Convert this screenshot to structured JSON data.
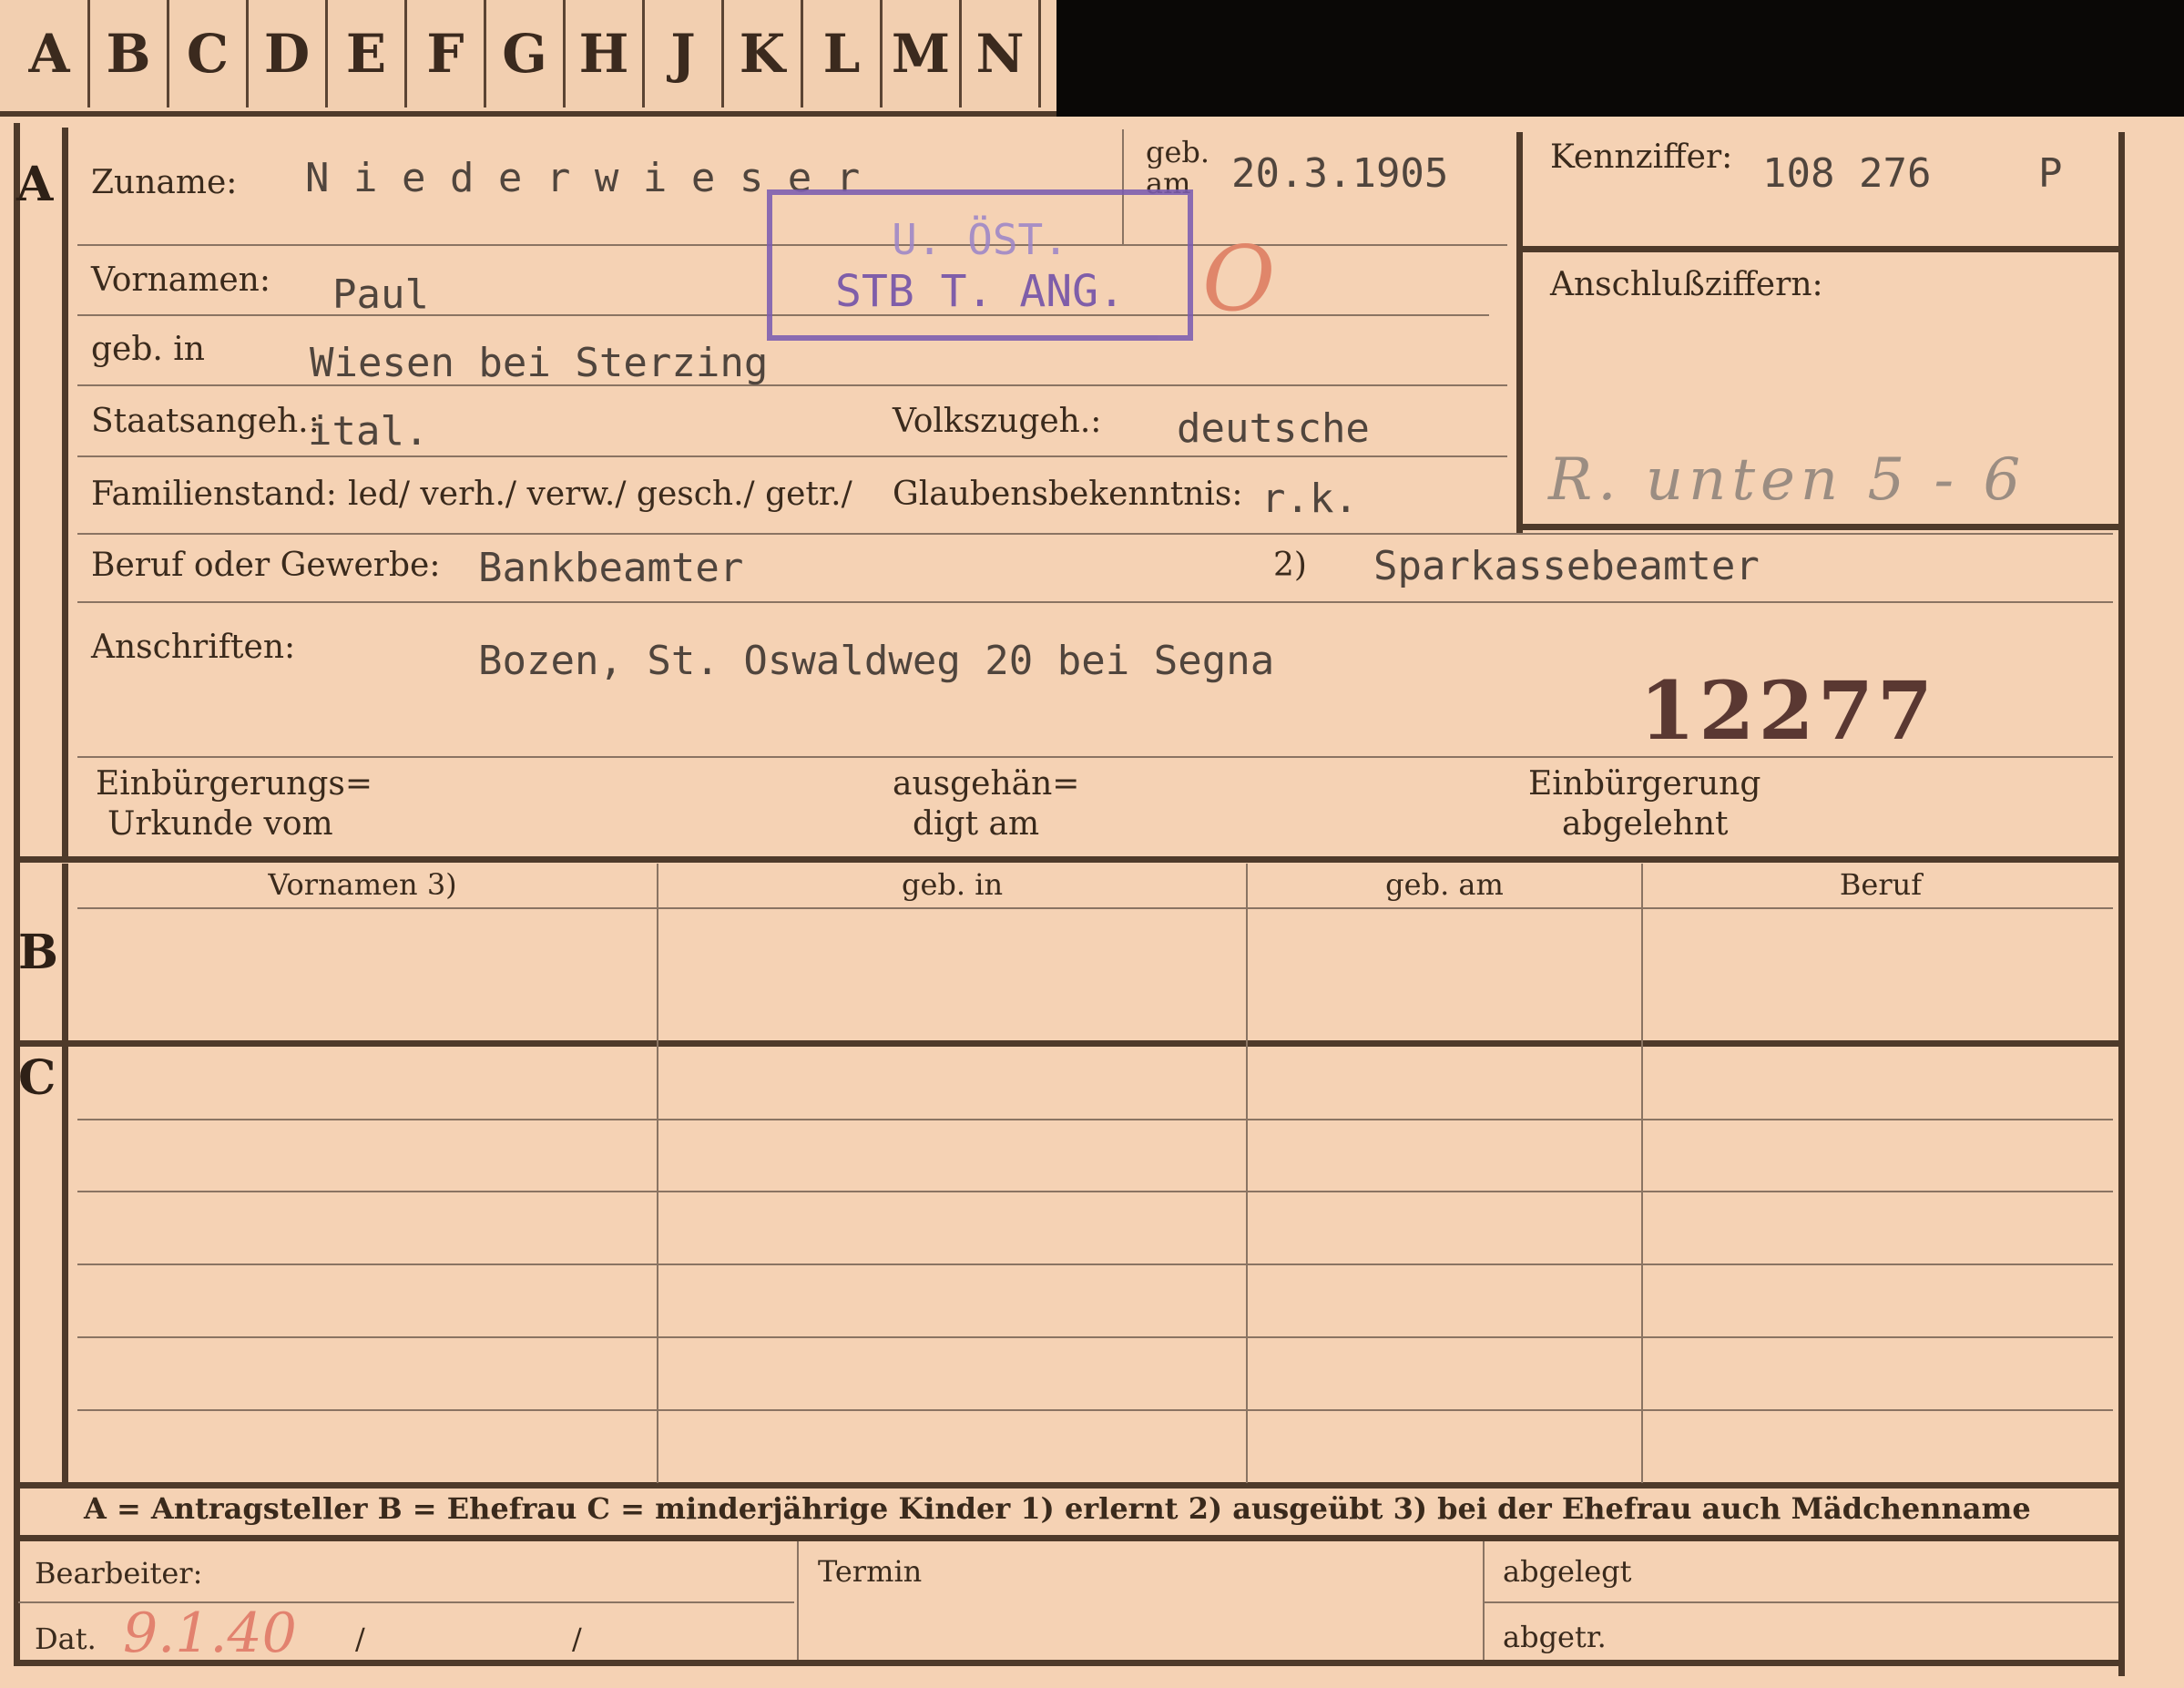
{
  "tabs": [
    "A",
    "B",
    "C",
    "D",
    "E",
    "F",
    "G",
    "H",
    "J",
    "K",
    "L",
    "M",
    "N"
  ],
  "sections": {
    "a": "A",
    "b": "B",
    "c": "C"
  },
  "labels": {
    "zuname": "Zuname:",
    "geb_am": "geb.\nam",
    "kennziffer": "Kennziffer:",
    "vornamen": "Vornamen:",
    "anschluss": "Anschlußziffern:",
    "geb_in": "geb. in",
    "staatsangeh": "Staatsangeh.:",
    "volkszugeh": "Volkszugeh.:",
    "familienstand": "Familienstand:",
    "familienstand_options": "led/ verh./ verw./ gesch./ getr./",
    "glaubens": "Glaubensbekenntnis:",
    "beruf": "Beruf oder Gewerbe:",
    "beruf_note": "2)",
    "anschriften": "Anschriften:",
    "einb_urkunde_1": "Einbürgerungs=",
    "einb_urkunde_2": "Urkunde vom",
    "ausgehaend_1": "ausgehän=",
    "ausgehaend_2": "digt am",
    "einb_abgelehnt_1": "Einbürgerung",
    "einb_abgelehnt_2": "abgelehnt"
  },
  "values": {
    "zuname": "N i e d e r w i e s e r",
    "geb_am": "20.3.1905",
    "kennziffer": "108 276",
    "kennziffer_suffix": "P",
    "vornamen": "Paul",
    "geb_in": "Wiesen bei Sterzing",
    "staatsangeh": "ital.",
    "volkszugeh": "deutsche",
    "glaubens": "r.k.",
    "beruf": "Bankbeamter",
    "beruf_ausgeuebt": "Sparkassebeamter",
    "anschrift": "Bozen, St. Oswaldweg 20 bei Segna",
    "number": "12277"
  },
  "stamp": {
    "line1": "U.  ÖST.",
    "line2": "STB  T. ANG."
  },
  "handwriting": {
    "anschluss": "R. unten  5 - 6",
    "mark": "O",
    "datum": "9.1.40"
  },
  "table_headers": [
    "Vornamen 3)",
    "geb. in",
    "geb. am",
    "Beruf"
  ],
  "legend": "A = Antragsteller   B = Ehefrau   C = minderjährige Kinder   1) erlernt   2) ausgeübt   3) bei der Ehefrau auch Mädchenname",
  "footer": {
    "bearbeiter": "Bearbeiter:",
    "dat": "Dat.",
    "slash1": "/",
    "slash2": "/",
    "termin": "Termin",
    "abgelegt": "abgelegt",
    "abgetr": "abgetr."
  },
  "colors": {
    "card": "#f5d2b4",
    "line": "#4e3a2a",
    "stamp": "#7b5cb0",
    "red": "#d8806a",
    "pencil": "#8b7b70"
  }
}
